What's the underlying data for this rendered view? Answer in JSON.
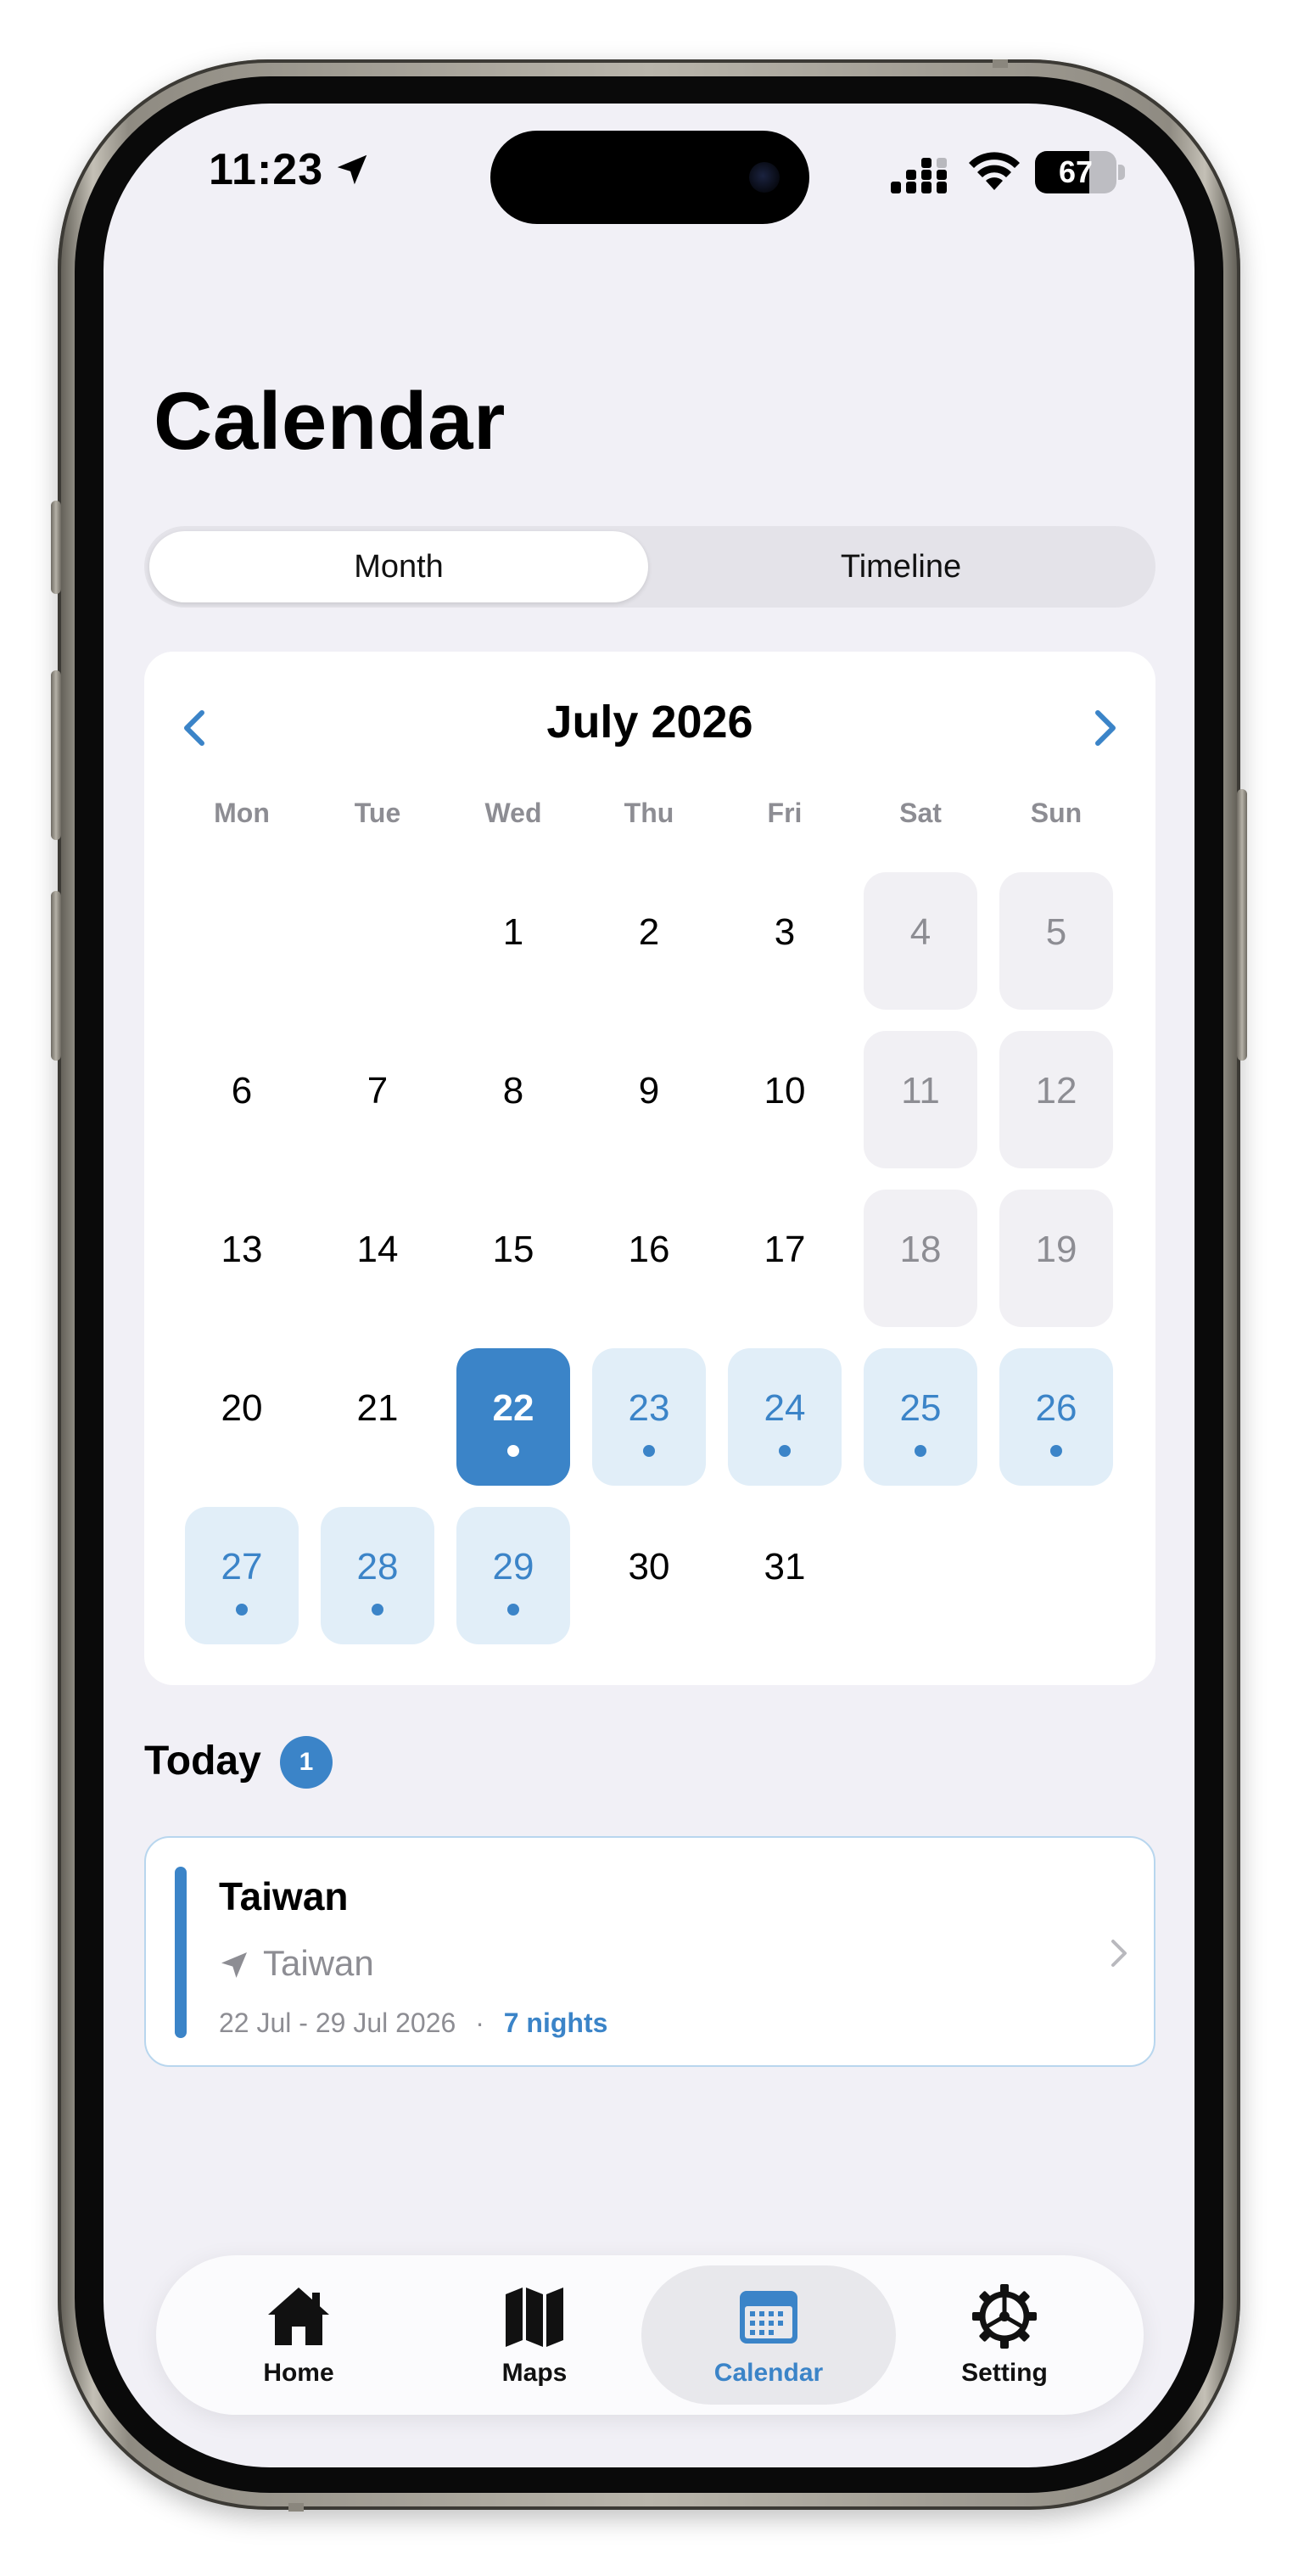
{
  "status_bar": {
    "time": "11:23",
    "battery_level": "67",
    "battery_fraction": 0.67
  },
  "page": {
    "title": "Calendar"
  },
  "segmented": {
    "options": [
      "Month",
      "Timeline"
    ],
    "selected": "Month"
  },
  "calendar": {
    "month_label": "July 2026",
    "weekdays": [
      "Mon",
      "Tue",
      "Wed",
      "Thu",
      "Fri",
      "Sat",
      "Sun"
    ],
    "selected_day": "22",
    "trip_days": [
      "22",
      "23",
      "24",
      "25",
      "26",
      "27",
      "28",
      "29"
    ],
    "days": [
      "1",
      "2",
      "3",
      "4",
      "5",
      "6",
      "7",
      "8",
      "9",
      "10",
      "11",
      "12",
      "13",
      "14",
      "15",
      "16",
      "17",
      "18",
      "19",
      "20",
      "21",
      "22",
      "23",
      "24",
      "25",
      "26",
      "27",
      "28",
      "29",
      "30",
      "31"
    ]
  },
  "today": {
    "title": "Today",
    "count": "1",
    "trip": {
      "title": "Taiwan",
      "location": "Taiwan",
      "dates": "22 Jul - 29 Jul 2026",
      "separator": "·",
      "nights": "7 nights"
    }
  },
  "tab_bar": {
    "items": [
      {
        "label": "Home",
        "icon": "home-icon"
      },
      {
        "label": "Maps",
        "icon": "map-icon"
      },
      {
        "label": "Calendar",
        "icon": "calendar-icon"
      },
      {
        "label": "Setting",
        "icon": "gear-icon"
      }
    ],
    "active": "Calendar"
  },
  "colors": {
    "accent": "#3b84c8",
    "range_bg": "#e1eef8",
    "weekend_bg": "#f1f0f4",
    "screen_bg": "#f1f0f6"
  }
}
